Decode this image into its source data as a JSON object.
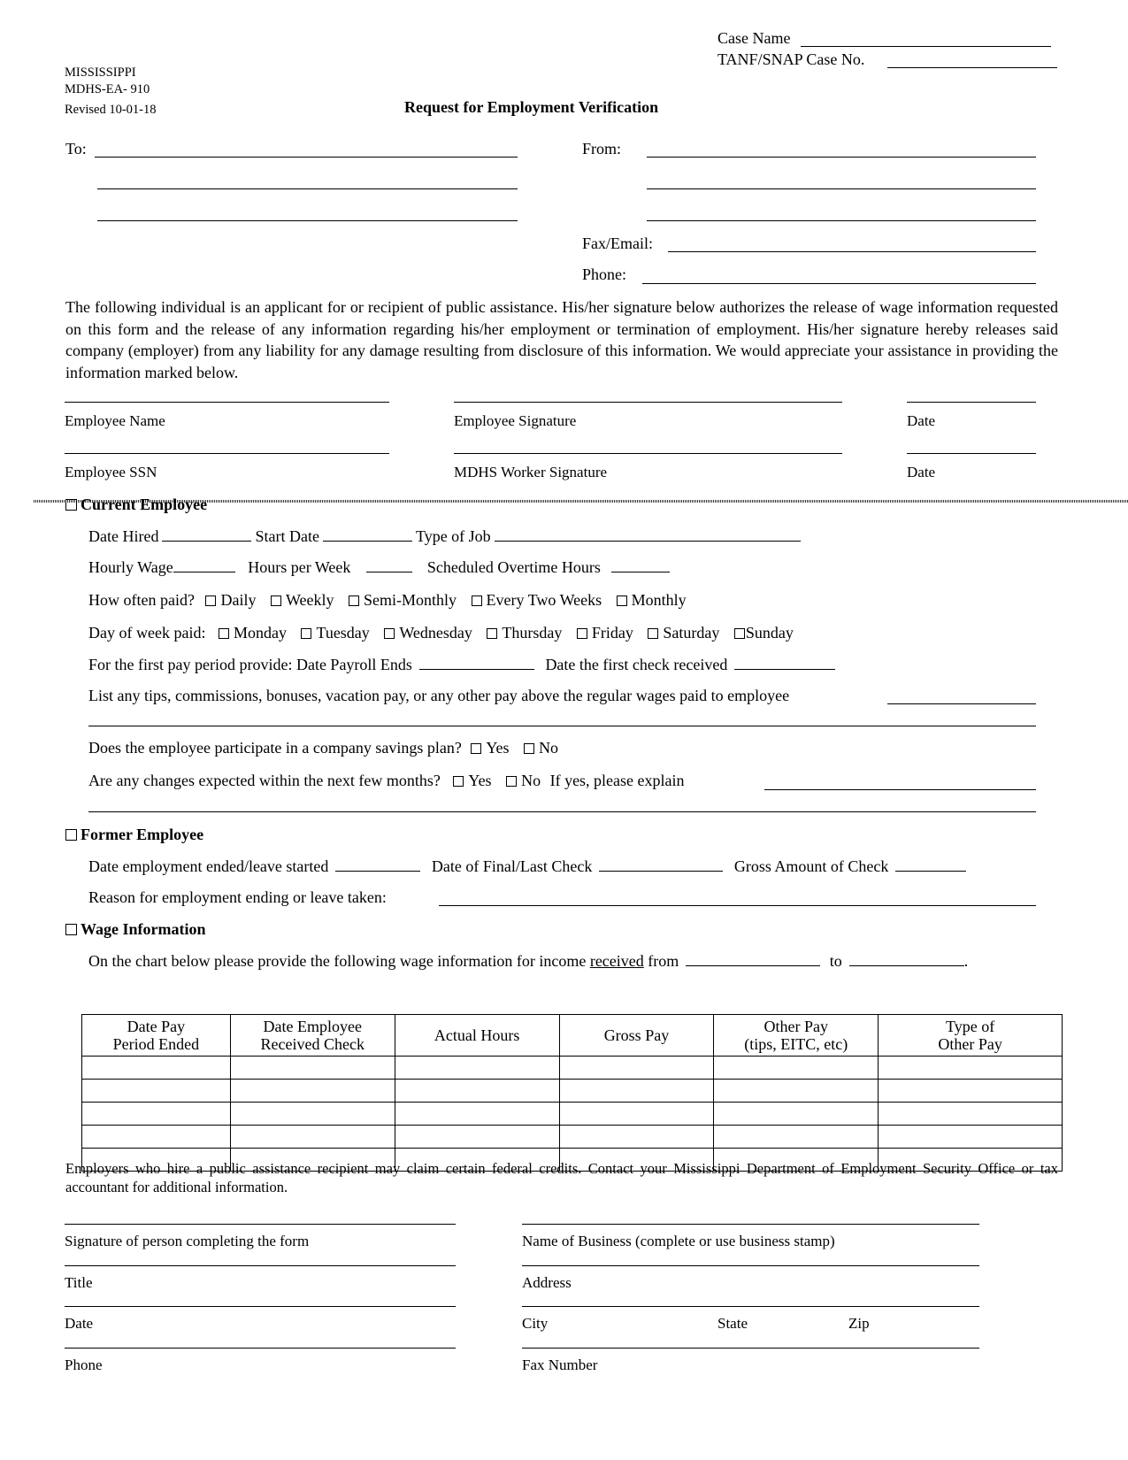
{
  "header": {
    "state": "MISSISSIPPI",
    "form_number": "MDHS-EA- 910",
    "revised": "Revised 10-01-18",
    "title": "Request for Employment Verification",
    "case_name_label": "Case Name",
    "case_no_label": "TANF/SNAP Case No."
  },
  "address": {
    "to_label": "To:",
    "from_label": "From:",
    "fax_email_label": "Fax/Email:",
    "phone_label": "Phone:"
  },
  "authorization_text": "The following individual is an applicant for or recipient of public assistance. His/her signature below authorizes the release of wage information requested on this form and the release of any information regarding his/her employment or termination of employment. His/her signature hereby releases said company (employer) from any liability for any damage resulting from disclosure of this information.  We would appreciate your assistance in providing the information marked below.",
  "signatures": {
    "employee_name": "Employee Name",
    "employee_signature": "Employee Signature",
    "date1": "Date",
    "employee_ssn": "Employee SSN",
    "worker_signature": "MDHS Worker Signature",
    "date2": "Date"
  },
  "current_employee": {
    "heading": "Current Employee",
    "date_hired": "Date Hired",
    "start_date": "Start Date",
    "type_of_job": "Type of Job",
    "hourly_wage": "Hourly Wage",
    "hours_per_week": "Hours per Week",
    "overtime_hours": "Scheduled Overtime Hours",
    "how_often_label": "How often paid?",
    "how_often_options": [
      "Daily",
      "Weekly",
      "Semi-Monthly",
      "Every Two Weeks",
      "Monthly"
    ],
    "day_paid_label": "Day of week paid:",
    "day_options": [
      "Monday",
      "Tuesday",
      "Wednesday",
      "Thursday",
      "Friday",
      "Saturday",
      "Sunday"
    ],
    "first_pay_label": "For the first pay period provide:  Date Payroll Ends",
    "first_check_label": "Date the first check received",
    "tips_label": "List any tips, commissions, bonuses, vacation pay, or any other pay above the regular wages paid to employee",
    "savings_label": "Does the employee participate in a company savings plan?",
    "changes_label": "Are any changes expected within the next few months?",
    "yes": "Yes",
    "no": "No",
    "explain_label": "If yes, please explain"
  },
  "former_employee": {
    "heading": "Former Employee",
    "date_ended": "Date employment ended/leave started",
    "final_check": "Date of Final/Last Check",
    "gross_amount": "Gross Amount of Check",
    "reason": "Reason for employment ending or leave taken:"
  },
  "wage_information": {
    "heading": "Wage Information",
    "intro_before": "On the chart below please provide the following wage information for income",
    "intro_underlined": "received",
    "intro_from": "from",
    "intro_to": "to",
    "intro_end": ".",
    "columns": [
      [
        "Date Pay",
        "Period Ended"
      ],
      [
        "Date Employee",
        "Received Check"
      ],
      [
        "Actual Hours"
      ],
      [
        "Gross Pay"
      ],
      [
        "Other Pay",
        "(tips, EITC, etc)"
      ],
      [
        "Type of",
        "Other Pay"
      ]
    ],
    "rows": [
      [
        "",
        "",
        "",
        "",
        "",
        ""
      ],
      [
        "",
        "",
        "",
        "",
        "",
        ""
      ],
      [
        "",
        "",
        "",
        "",
        "",
        ""
      ],
      [
        "",
        "",
        "",
        "",
        "",
        ""
      ],
      [
        "",
        "",
        "",
        "",
        "",
        ""
      ]
    ]
  },
  "credits_note": "Employers who hire a public assistance recipient may claim certain federal credits.  Contact your Mississippi Department of Employment Security Office or tax accountant for additional information.",
  "footer": {
    "signature_person": "Signature of person completing the form",
    "title": "Title",
    "date": "Date",
    "phone": "Phone",
    "business_name": "Name of Business (complete or use business stamp)",
    "address": "Address",
    "city": "City",
    "state": "State",
    "zip": "Zip",
    "fax": "Fax Number"
  }
}
